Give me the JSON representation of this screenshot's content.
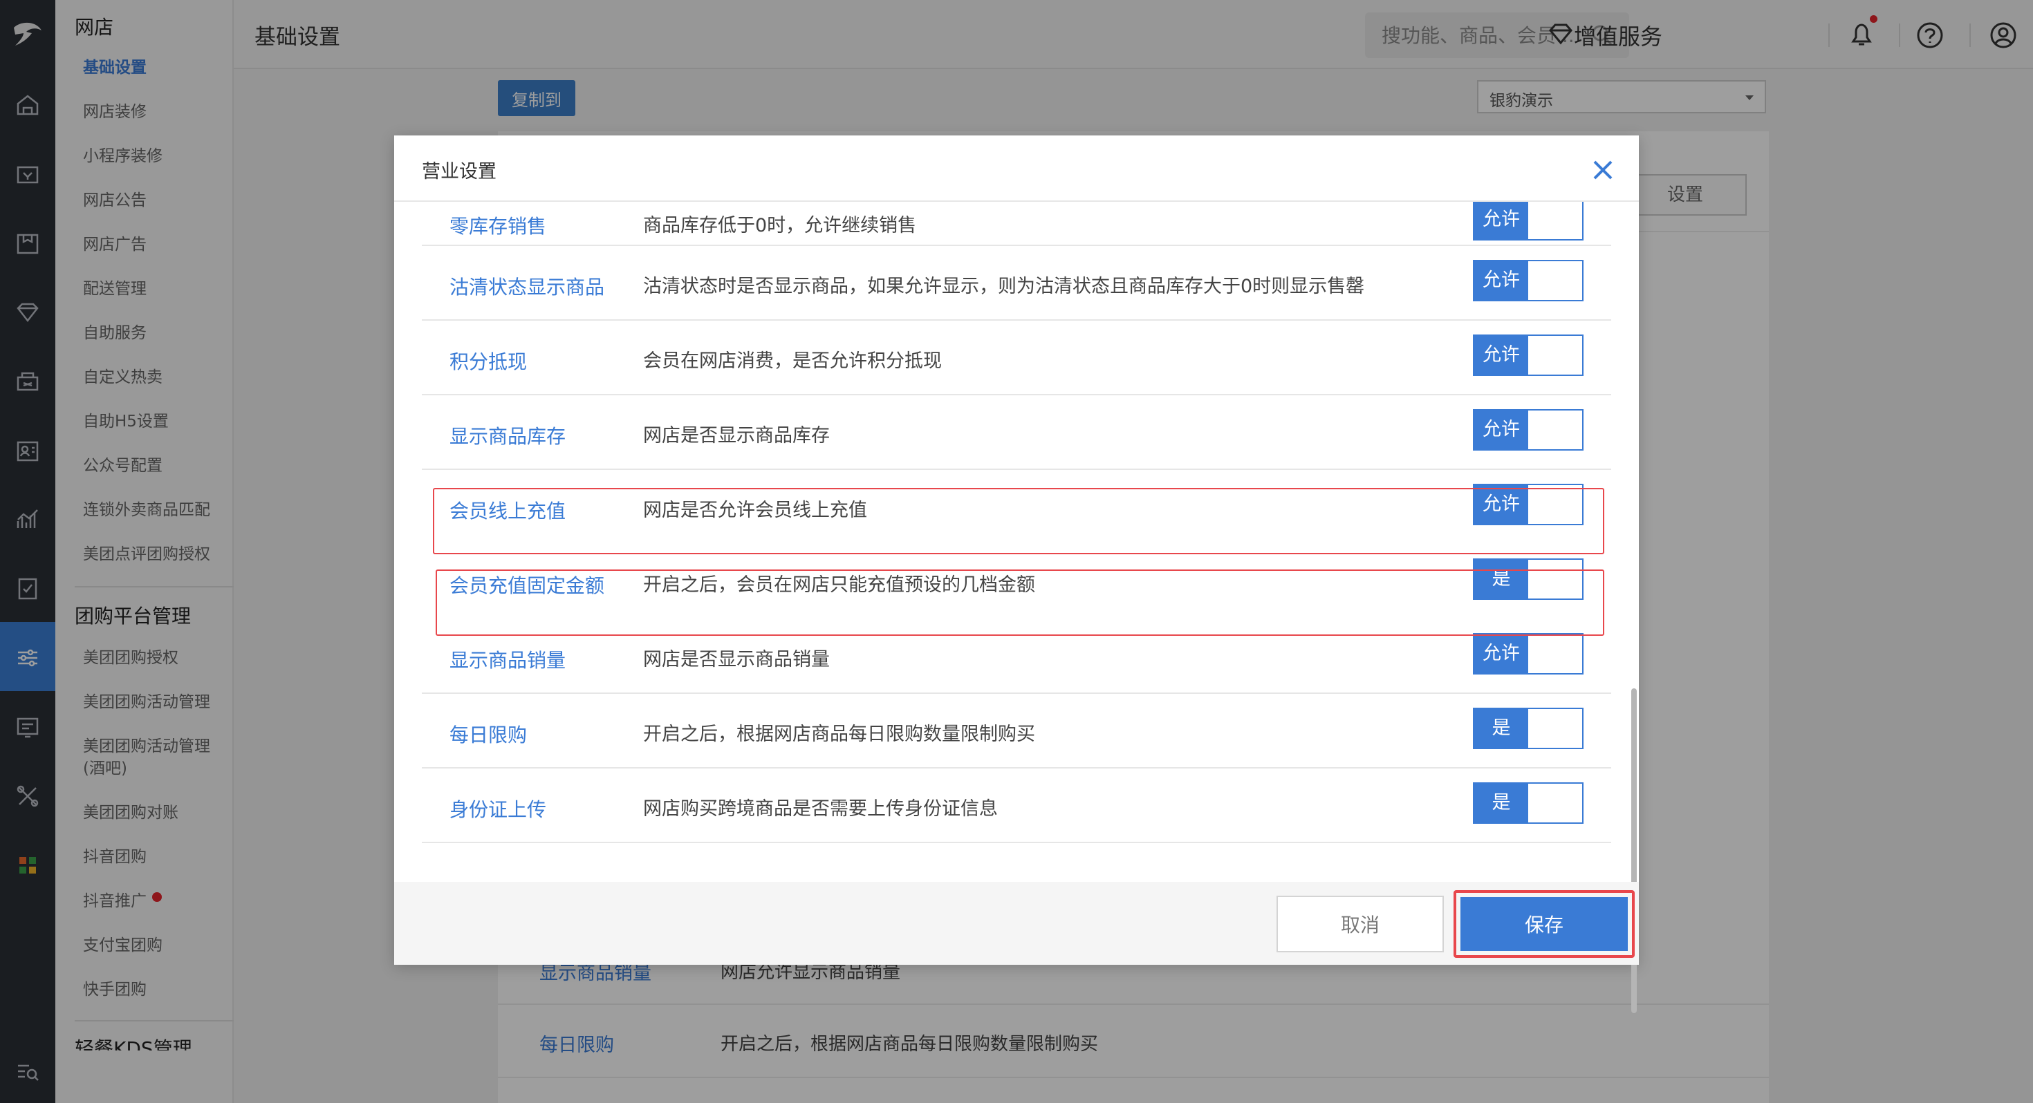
{
  "nav": {
    "group1": "网店",
    "items1": [
      "基础设置",
      "网店装修",
      "小程序装修",
      "网店公告",
      "网店广告",
      "配送管理",
      "自助服务",
      "自定义热卖",
      "自助H5设置",
      "公众号配置",
      "连锁外卖商品匹配",
      "美团点评团购授权"
    ],
    "group2": "团购平台管理",
    "items2": [
      "美团团购授权",
      "美团团购活动管理",
      "美团团购活动管理(酒吧)",
      "美团团购对账",
      "抖音团购",
      "抖音推广",
      "支付宝团购",
      "快手团购"
    ],
    "group3_partial": "轻餐KDS管理"
  },
  "topbar": {
    "page_title": "基础设置",
    "search_placeholder": "搜功能、商品、会员...",
    "value_added": "增值服务"
  },
  "content": {
    "copy_to": "复制到",
    "store_select": "银豹演示",
    "settings_button": "设置",
    "bg_rows": [
      {
        "name": "显示商品销量",
        "desc": "网店允许显示商品销量"
      },
      {
        "name": "每日限购",
        "desc": "开启之后，根据网店商品每日限购数量限制购买"
      }
    ]
  },
  "modal": {
    "title": "营业设置",
    "rows": [
      {
        "name": "零库存销售",
        "desc": "商品库存低于0时，允许继续销售",
        "toggle": "允许"
      },
      {
        "name": "沽清状态显示商品",
        "desc": "沽清状态时是否显示商品，如果允许显示，则为沽清状态且商品库存大于0时则显示售罄",
        "toggle": "允许"
      },
      {
        "name": "积分抵现",
        "desc": "会员在网店消费，是否允许积分抵现",
        "toggle": "允许"
      },
      {
        "name": "显示商品库存",
        "desc": "网店是否显示商品库存",
        "toggle": "允许"
      },
      {
        "name": "会员线上充值",
        "desc": "网店是否允许会员线上充值",
        "toggle": "允许"
      },
      {
        "name": "会员充值固定金额",
        "desc": "开启之后，会员在网店只能充值预设的几档金额",
        "toggle": "是"
      },
      {
        "name": "显示商品销量",
        "desc": "网店是否显示商品销量",
        "toggle": "允许"
      },
      {
        "name": "每日限购",
        "desc": "开启之后，根据网店商品每日限购数量限制购买",
        "toggle": "是"
      },
      {
        "name": "身份证上传",
        "desc": "网店购买跨境商品是否需要上传身份证信息",
        "toggle": "是"
      }
    ],
    "cancel": "取消",
    "save": "保存"
  },
  "colors": {
    "accent": "#3a7bd5",
    "highlight": "#e8474c",
    "rail": "#2b2f36"
  }
}
